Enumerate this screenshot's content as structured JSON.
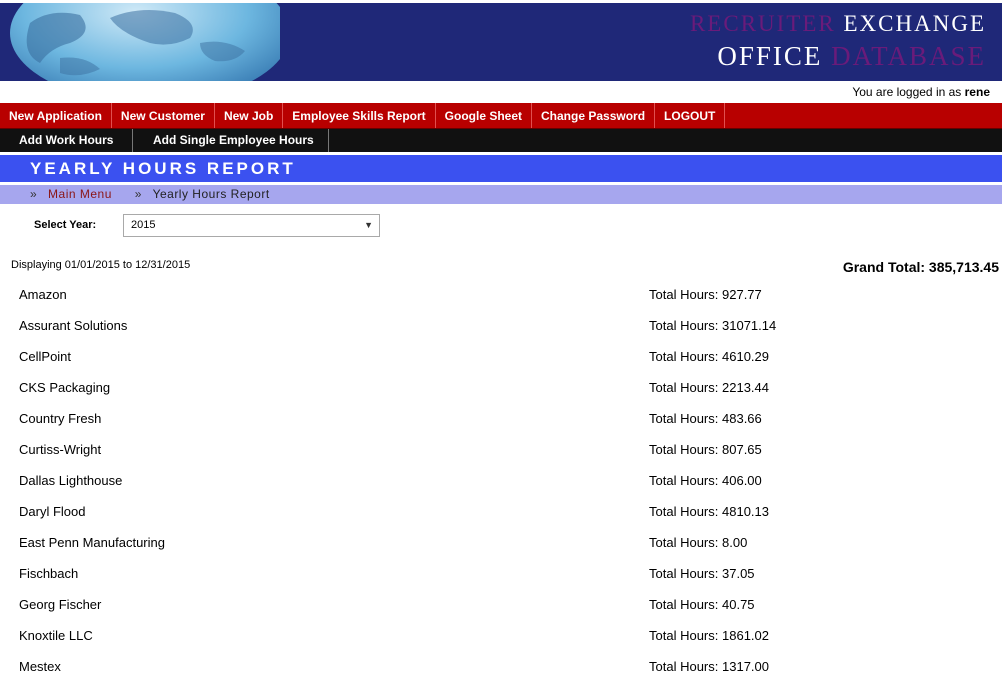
{
  "header": {
    "brand_line1_a": "RECRUITER",
    "brand_line1_b": "EXCHANGE",
    "brand_line2_a": "OFFICE",
    "brand_line2_b": "DATABASE"
  },
  "login": {
    "prefix": "You are logged in as",
    "user": "rene"
  },
  "menu_primary": [
    "New Application",
    "New Customer",
    "New Job",
    "Employee Skills Report",
    "Google Sheet",
    "Change Password",
    "LOGOUT"
  ],
  "menu_secondary": [
    "Add Work Hours",
    "Add Single Employee Hours"
  ],
  "page": {
    "title": "YEARLY HOURS REPORT"
  },
  "breadcrumb": {
    "sep": "»",
    "link": "Main Menu",
    "current": "Yearly Hours Report"
  },
  "filter": {
    "label": "Select Year:",
    "selected_year": "2015"
  },
  "report": {
    "display_range": "Displaying 01/01/2015 to 12/31/2015",
    "grand_total_label": "Grand Total:",
    "grand_total_value": "385,713.45",
    "total_label": "Total Hours:",
    "rows": [
      {
        "name": "Amazon",
        "hours": "927.77"
      },
      {
        "name": "Assurant Solutions",
        "hours": "31071.14"
      },
      {
        "name": "CellPoint",
        "hours": "4610.29"
      },
      {
        "name": "CKS Packaging",
        "hours": "2213.44"
      },
      {
        "name": "Country Fresh",
        "hours": "483.66"
      },
      {
        "name": "Curtiss-Wright",
        "hours": "807.65"
      },
      {
        "name": "Dallas Lighthouse",
        "hours": "406.00"
      },
      {
        "name": "Daryl Flood",
        "hours": "4810.13"
      },
      {
        "name": "East Penn Manufacturing",
        "hours": "8.00"
      },
      {
        "name": "Fischbach",
        "hours": "37.05"
      },
      {
        "name": "Georg Fischer",
        "hours": "40.75"
      },
      {
        "name": "Knoxtile LLC",
        "hours": "1861.02"
      },
      {
        "name": "Mestex",
        "hours": "1317.00"
      }
    ]
  },
  "colors": {
    "banner": "#1f2878",
    "menu_red": "#b80000",
    "menu_black": "#111111",
    "title_bar": "#3b51f0",
    "breadcrumb_bar": "#a6a6ee",
    "brand_purple": "#6a1b7a"
  }
}
